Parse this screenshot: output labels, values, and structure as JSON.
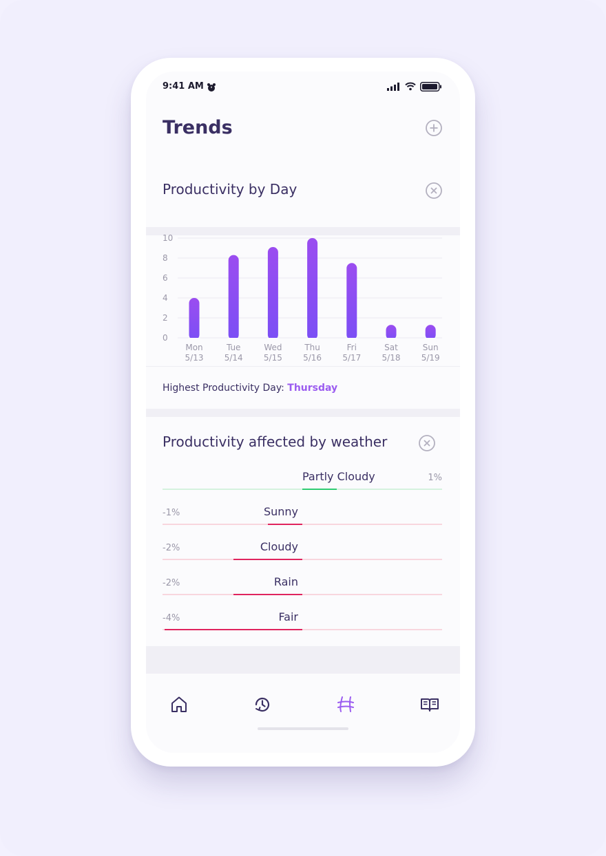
{
  "status_bar": {
    "time": "9:41 AM"
  },
  "header": {
    "title": "Trends",
    "add_icon": "plus-circle-icon"
  },
  "productivity_card": {
    "title": "Productivity by Day",
    "close_icon": "close-circle-icon",
    "highlight_label": "Highest Productivity Day: ",
    "highlight_value": "Thursday"
  },
  "chart_data": {
    "type": "bar",
    "categories": [
      "Mon 5/13",
      "Tue 5/14",
      "Wed 5/15",
      "Thu 5/16",
      "Fri 5/17",
      "Sat 5/18",
      "Sun 5/19"
    ],
    "category_lines": [
      [
        "Mon",
        "5/13"
      ],
      [
        "Tue",
        "5/14"
      ],
      [
        "Wed",
        "5/15"
      ],
      [
        "Thu",
        "5/16"
      ],
      [
        "Fri",
        "5/17"
      ],
      [
        "Sat",
        "5/18"
      ],
      [
        "Sun",
        "5/19"
      ]
    ],
    "values": [
      4,
      8.3,
      9.1,
      10,
      7.5,
      1.3,
      1.3
    ],
    "y_ticks": [
      "0",
      "2",
      "4",
      "6",
      "8",
      "10"
    ],
    "ylim": [
      0,
      10
    ],
    "grid": true,
    "bar_color_top": "#9b4df0",
    "bar_color_bottom": "#7b4ff5"
  },
  "weather_card": {
    "title": "Productivity affected by weather",
    "close_icon": "close-circle-icon",
    "rows": [
      {
        "label": "Partly Cloudy",
        "value_text": "1%",
        "value": 1,
        "sign": "positive"
      },
      {
        "label": "Sunny",
        "value_text": "-1%",
        "value": -1,
        "sign": "negative"
      },
      {
        "label": "Cloudy",
        "value_text": "-2%",
        "value": -2,
        "sign": "negative"
      },
      {
        "label": "Rain",
        "value_text": "-2%",
        "value": -2,
        "sign": "negative"
      },
      {
        "label": "Fair",
        "value_text": "-4%",
        "value": -4,
        "sign": "negative"
      }
    ],
    "colors": {
      "positive": "#2ecc71",
      "positive_track": "#d4f2de",
      "negative": "#e0245e",
      "negative_track": "#f8d6de"
    }
  },
  "tab_bar": {
    "tabs": [
      {
        "name": "home",
        "icon": "home-icon",
        "active": false
      },
      {
        "name": "history",
        "icon": "history-clock-icon",
        "active": false
      },
      {
        "name": "trends",
        "icon": "trends-icon",
        "active": true
      },
      {
        "name": "journal",
        "icon": "book-icon",
        "active": false
      }
    ],
    "active_color": "#9b5cf0",
    "inactive_color": "#3a2f63"
  }
}
